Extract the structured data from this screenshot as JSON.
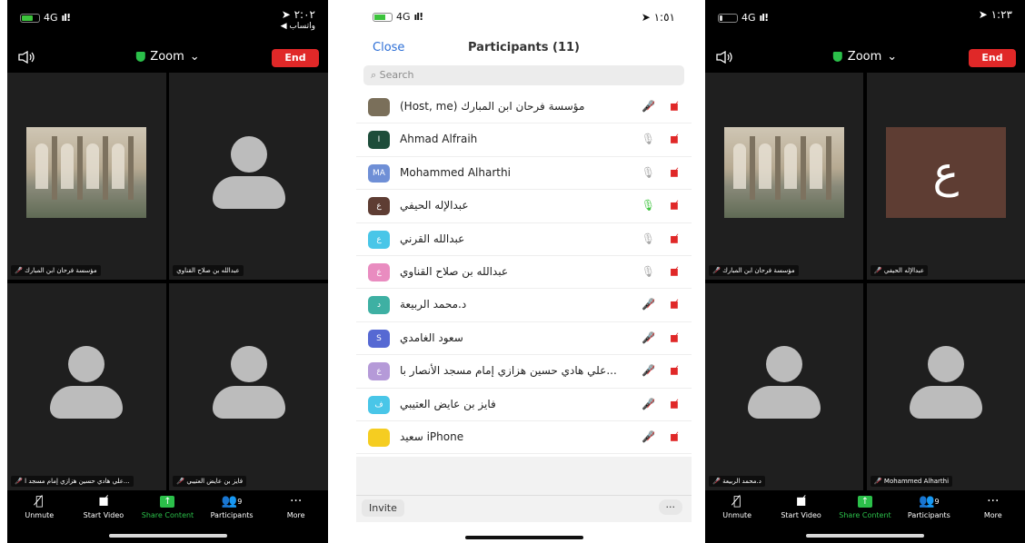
{
  "left_screen": {
    "status_bar": {
      "network": "4G",
      "time": "٢:٠٢",
      "back_app": "◀ واتساب"
    },
    "meeting_title": "Zoom",
    "end_label": "End",
    "tiles": [
      {
        "name": "مؤسسة فرحان ابن المبارك",
        "muted": true
      },
      {
        "name": "عبدالله بن صلاح القناوي",
        "muted": false
      },
      {
        "name": "علي هادي حسين هزازي إمام مسجد ا...",
        "muted": true
      },
      {
        "name": "فايز بن عايض العتيبي",
        "muted": true
      }
    ],
    "toolbar": {
      "unmute": "Unmute",
      "start_video": "Start Video",
      "share": "Share Content",
      "participants": "Participants",
      "participants_count": "9",
      "more": "More"
    }
  },
  "middle_screen": {
    "status_bar": {
      "network": "4G",
      "time": "١:٥١"
    },
    "close": "Close",
    "title": "Participants (11)",
    "search_placeholder": "Search",
    "participants": [
      {
        "name": "(Host, me) مؤسسة فرحان ابن المبارك",
        "avatar": "",
        "avatar_color": "#7a6f5a",
        "mic": "muted"
      },
      {
        "name": "Ahmad Alfraih",
        "avatar": "I",
        "avatar_color": "#1e4d3a",
        "mic": "on"
      },
      {
        "name": "Mohammed Alharthi",
        "avatar": "MA",
        "avatar_color": "#6f8fd6",
        "mic": "on"
      },
      {
        "name": "عبدالإله الحيفي",
        "avatar": "ع",
        "avatar_color": "#5e3d33",
        "mic": "active"
      },
      {
        "name": "عبدالله القرني",
        "avatar": "ع",
        "avatar_color": "#49c6e8",
        "mic": "on"
      },
      {
        "name": "عبدالله بن صلاح القناوي",
        "avatar": "ع",
        "avatar_color": "#e98cc0",
        "mic": "on"
      },
      {
        "name": "د.محمد الربيعة",
        "avatar": "د",
        "avatar_color": "#3eb0a3",
        "mic": "muted"
      },
      {
        "name": "سعود الغامدي",
        "avatar": "S",
        "avatar_color": "#5669d3",
        "mic": "muted"
      },
      {
        "name": "علي هادي حسين هزازي إمام مسجد الأنصار با...",
        "avatar": "ع",
        "avatar_color": "#b59ad8",
        "mic": "muted"
      },
      {
        "name": "فايز بن عايض العتيبي",
        "avatar": "ف",
        "avatar_color": "#49c6e8",
        "mic": "muted"
      },
      {
        "name": "سعيد iPhone",
        "avatar": "",
        "avatar_color": "#f5cd21",
        "mic": "muted"
      }
    ],
    "invite": "Invite",
    "more": "···"
  },
  "right_screen": {
    "status_bar": {
      "network": "4G",
      "time": "١:٢٣"
    },
    "meeting_title": "Zoom",
    "end_label": "End",
    "tiles": [
      {
        "name": "مؤسسة فرحان ابن المبارك",
        "muted": true
      },
      {
        "name": "عبدالإله الحيفي",
        "muted": true,
        "letter": "ع"
      },
      {
        "name": "د.محمد الربيعة",
        "muted": true
      },
      {
        "name": "Mohammed Alharthi",
        "muted": true
      }
    ],
    "toolbar": {
      "unmute": "Unmute",
      "start_video": "Start Video",
      "share": "Share Content",
      "participants": "Participants",
      "participants_count": "9",
      "more": "More"
    }
  }
}
